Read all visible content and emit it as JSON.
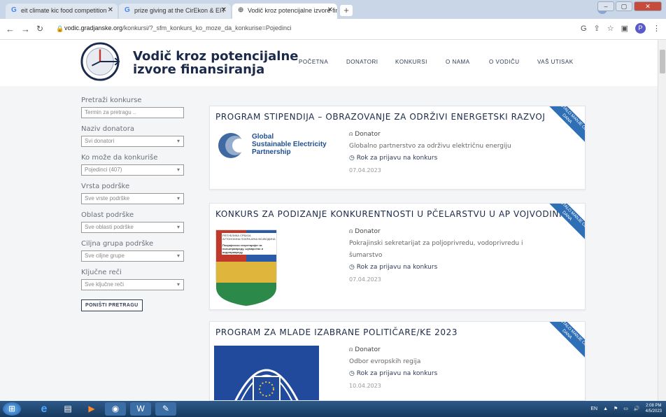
{
  "browser": {
    "tabs": [
      {
        "label": "eit climate kic food competition"
      },
      {
        "label": "prize giving at the CirEkon & EIT"
      },
      {
        "label": "Vodič kroz potencijalne izvore fin"
      }
    ],
    "url_domain": "vodic.gradjanske.org",
    "url_path": "/konkursi/?_sfm_konkurs_ko_moze_da_konkurise=Pojedinci",
    "profile_initial": "P"
  },
  "site": {
    "logo_line1": "Vodič kroz potencijalne",
    "logo_line2": "izvore finansiranja",
    "nav": [
      "POČETNA",
      "DONATORI",
      "KONKURSI",
      "O NAMA",
      "O VODIČU",
      "VAŠ UTISAK"
    ]
  },
  "filters": {
    "search_label": "Pretraži konkurse",
    "search_placeholder": "Termin za pretragu ..",
    "donor_label": "Naziv donatora",
    "donor_value": "Svi donatori",
    "who_label": "Ko može da konkuriše",
    "who_value": "Pojedinci (407)",
    "type_label": "Vrsta podrške",
    "type_value": "Sve vrste podrške",
    "area_label": "Oblast podrške",
    "area_value": "Sve oblasti podrške",
    "target_label": "Ciljna grupa podrške",
    "target_value": "Sve ciljne grupe",
    "keywords_label": "Ključne reči",
    "keywords_value": "Sve ključne reči",
    "reset_label": "PONIŠTI PRETRAGU"
  },
  "cards": [
    {
      "title": "PROGRAM STIPENDIJA – OBRAZOVANJE ZA ODRŽIVI ENERGETSKI RAZVOJ",
      "ribbon": "PREOSTALO MANJE OD 7 DANA",
      "logo_l1": "Global",
      "logo_l2": "Sustainable Electricity",
      "logo_l3": "Partnership",
      "donor_label": "Donator",
      "donor": "Globalno partnerstvo za održivu električnu energiju",
      "deadline_label": "Rok za prijavu na konkurs",
      "deadline": "07.04.2023"
    },
    {
      "title": "KONKURS ZA PODIZANJE KONKURENTNOSTI U PČELARSTVU U AP VOJVODINI",
      "ribbon": "PREOSTALO MANJE OD 7 DANA",
      "logo_l1": "РЕПУБЛИКА СРБИЈА",
      "logo_l2": "АУТОНОМНА ПОКРАЈИНА ВОЈВОДИНА",
      "logo_l3": "Покрајински секретаријат за пољопривреду, шумарство и водопривреду",
      "donor_label": "Donator",
      "donor": "Pokrajinski sekretarijat za poljoprivredu, vodoprivredu i šumarstvo",
      "deadline_label": "Rok za prijavu na konkurs",
      "deadline": "07.04.2023"
    },
    {
      "title": "PROGRAM ZA MLADE IZABRANE POLITIČARE/KE 2023",
      "ribbon": "PREOSTALO MANJE OD 7 DANA",
      "donor_label": "Donator",
      "donor": "Odbor evropskih regija",
      "deadline_label": "Rok za prijavu na konkurs",
      "deadline": "10.04.2023"
    }
  ],
  "taskbar": {
    "lang": "EN",
    "time": "2:08 PM",
    "date": "4/5/2023"
  }
}
